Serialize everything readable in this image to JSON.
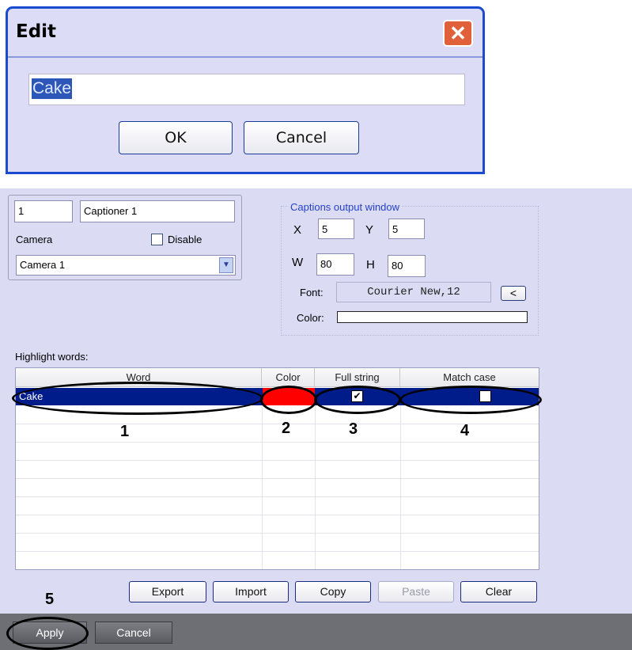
{
  "edit_dialog": {
    "title": "Edit",
    "close_glyph": "✕",
    "input_value": "Cake",
    "ok_label": "OK",
    "cancel_label": "Cancel"
  },
  "camera_group": {
    "id_value": "1",
    "name_value": "Captioner 1",
    "camera_label": "Camera",
    "disable_label": "Disable",
    "disable_checked": false,
    "camera_select_value": "Camera 1"
  },
  "captions_window": {
    "title": "Captions output window",
    "x_label": "X",
    "x_value": "5",
    "y_label": "Y",
    "y_value": "5",
    "w_label": "W",
    "w_value": "80",
    "h_label": "H",
    "h_value": "80",
    "font_label": "Font:",
    "font_value": "Courier New,12",
    "font_button": "<",
    "color_label": "Color:"
  },
  "highlight": {
    "label": "Highlight words:",
    "columns": [
      "Word",
      "Color",
      "Full string",
      "Match case"
    ],
    "rows": [
      {
        "word": "Cake",
        "color": "#ff0000",
        "full_string": true,
        "match_case": false
      }
    ]
  },
  "annotations": [
    "1",
    "2",
    "3",
    "4",
    "5"
  ],
  "table_buttons": {
    "export": "Export",
    "import": "Import",
    "copy": "Copy",
    "paste": "Paste",
    "clear": "Clear"
  },
  "footer": {
    "apply": "Apply",
    "cancel": "Cancel"
  },
  "colors": {
    "selection": "#001c8a",
    "word_color": "#ff0000",
    "dialog_border": "#1a4ad0",
    "panel_bg": "#dbdcf4"
  }
}
